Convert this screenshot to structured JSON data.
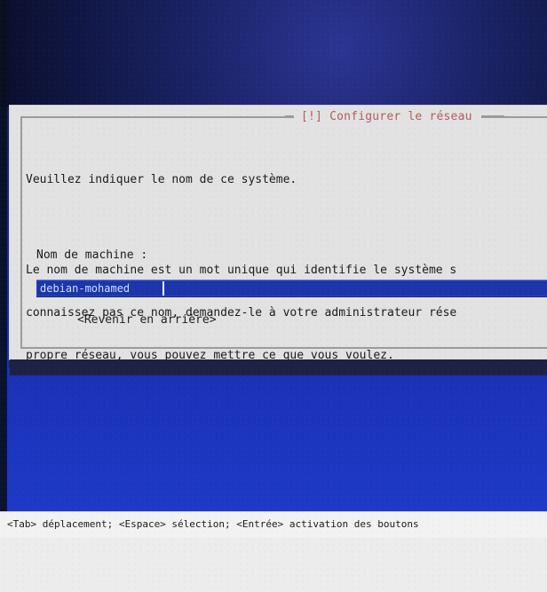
{
  "dialog": {
    "title": "[!] Configurer le réseau",
    "prompt": "Veuillez indiquer le nom de ce système.",
    "paragraph_lines": [
      "Le nom de machine est un mot unique qui identifie le système s",
      "connaissez pas ce nom, demandez-le à votre administrateur rése",
      "propre réseau, vous pouvez mettre ce que vous voulez."
    ],
    "field_label": "Nom de machine :",
    "hostname_value": "debian-mohamed",
    "back_button_label": "<Revenir en arrière>"
  },
  "status_bar": {
    "text": "<Tab> déplacement; <Espace> sélection; <Entrée> activation des boutons"
  },
  "colors": {
    "screen_blue": "#1a30b3",
    "dialog_gray": "#e2e2e2",
    "title_red": "#b25d59",
    "field_blue": "#1d35aa"
  }
}
